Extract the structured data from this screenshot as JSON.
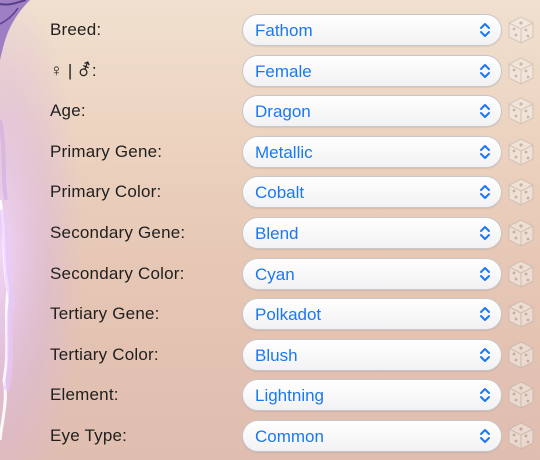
{
  "icons": {
    "chevron": "chevron-up-down-icon",
    "randomize": "dice-icon"
  },
  "colors": {
    "select_text": "#1a78f2",
    "label_text": "#1f1f1f",
    "background": "#ecd3c0",
    "decor_purple": "#b89ad8"
  },
  "form": {
    "rows": [
      {
        "label": "Breed:",
        "value": "Fathom"
      },
      {
        "label": "♀ | ⚦:",
        "value": "Female"
      },
      {
        "label": "Age:",
        "value": "Dragon"
      },
      {
        "label": "Primary Gene:",
        "value": "Metallic"
      },
      {
        "label": "Primary Color:",
        "value": "Cobalt"
      },
      {
        "label": "Secondary Gene:",
        "value": "Blend"
      },
      {
        "label": "Secondary Color:",
        "value": "Cyan"
      },
      {
        "label": "Tertiary Gene:",
        "value": "Polkadot"
      },
      {
        "label": "Tertiary Color:",
        "value": "Blush"
      },
      {
        "label": "Element:",
        "value": "Lightning"
      },
      {
        "label": "Eye Type:",
        "value": "Common"
      }
    ]
  }
}
